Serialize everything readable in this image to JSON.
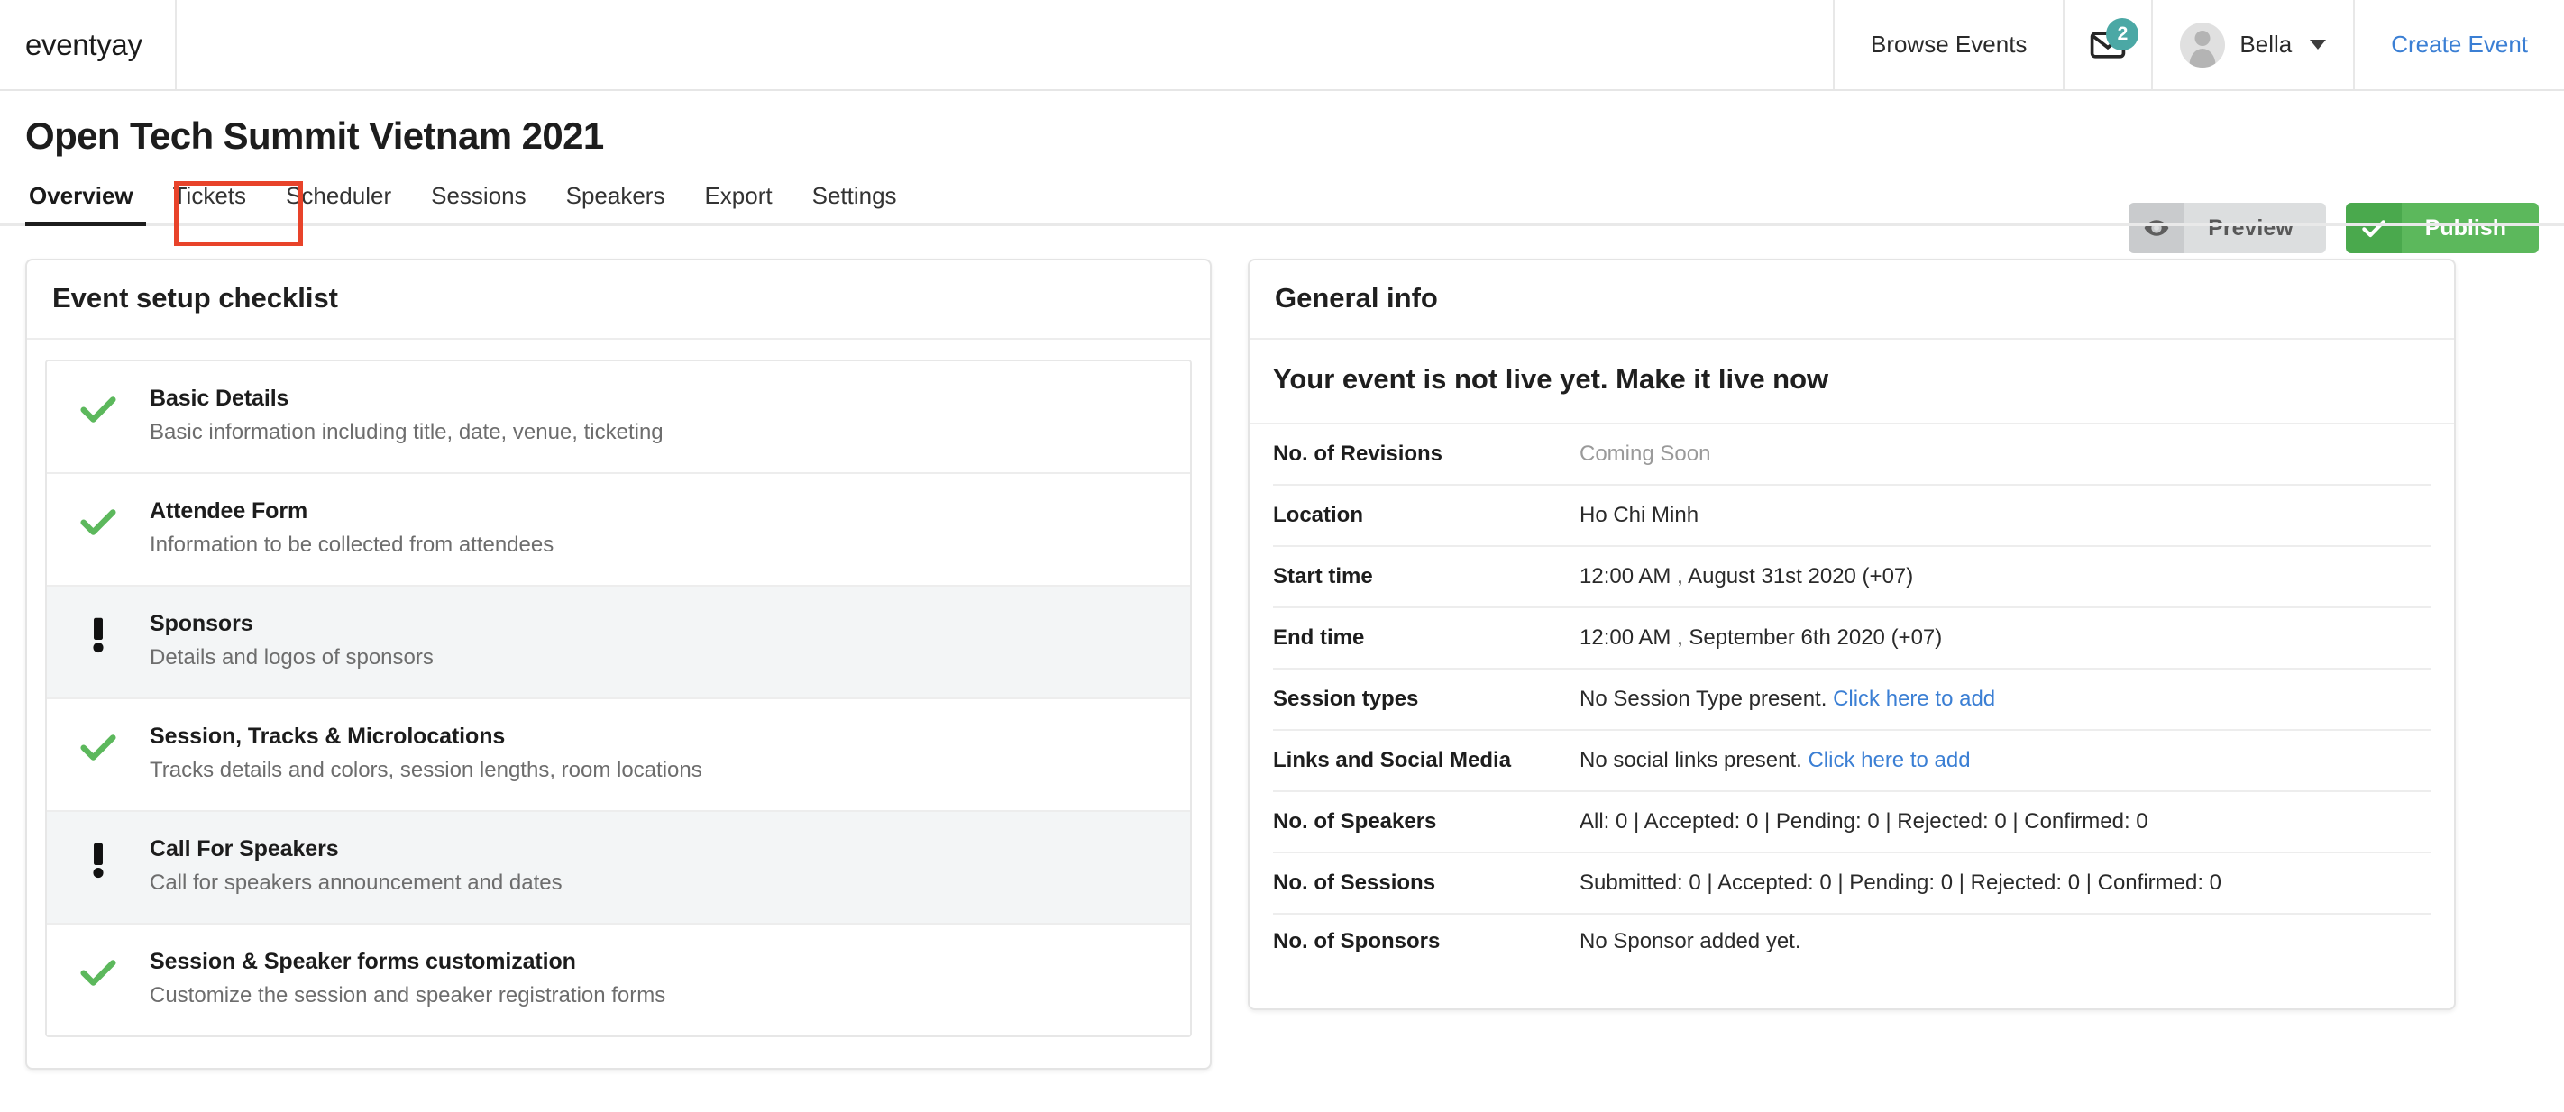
{
  "brand": {
    "name": "eventyay"
  },
  "navbar": {
    "browse_events": "Browse Events",
    "mail_icon": "mail-icon",
    "mail_badge_count": "2",
    "user_name": "Bella",
    "create_event": "Create Event",
    "badge_color": "#4ba8a5",
    "link_color": "#3b7fd4"
  },
  "header": {
    "title": "Open Tech Summit Vietnam 2021",
    "preview_label": "Preview",
    "preview_icon": "eye-icon",
    "publish_label": "Publish",
    "publish_icon": "check-icon",
    "publish_color": "#5cb85c"
  },
  "tabs": {
    "items": [
      {
        "label": "Overview",
        "active": true
      },
      {
        "label": "Tickets",
        "active": false,
        "highlighted": true
      },
      {
        "label": "Scheduler",
        "active": false
      },
      {
        "label": "Sessions",
        "active": false
      },
      {
        "label": "Speakers",
        "active": false
      },
      {
        "label": "Export",
        "active": false
      },
      {
        "label": "Settings",
        "active": false
      }
    ],
    "highlight_color": "#e8432a"
  },
  "checklist_panel": {
    "title": "Event setup checklist",
    "items": [
      {
        "name": "Basic Details",
        "desc": "Basic information including title, date, venue, ticketing",
        "status": "complete",
        "icon": "check-icon"
      },
      {
        "name": "Attendee Form",
        "desc": "Information to be collected from attendees",
        "status": "complete",
        "icon": "check-icon"
      },
      {
        "name": "Sponsors",
        "desc": "Details and logos of sponsors",
        "status": "incomplete",
        "icon": "exclamation-icon"
      },
      {
        "name": "Session, Tracks & Microlocations",
        "desc": "Tracks details and colors, session lengths, room locations",
        "status": "complete",
        "icon": "check-icon"
      },
      {
        "name": "Call For Speakers",
        "desc": "Call for speakers announcement and dates",
        "status": "incomplete",
        "icon": "exclamation-icon"
      },
      {
        "name": "Session & Speaker forms customization",
        "desc": "Customize the session and speaker registration forms",
        "status": "complete",
        "icon": "check-icon"
      }
    ],
    "complete_color": "#5cb85c"
  },
  "general_info": {
    "title": "General info",
    "live_notice": "Your event is not live yet. Make it live now",
    "rows": [
      {
        "label": "No. of Revisions",
        "value": "Coming Soon",
        "muted": true
      },
      {
        "label": "Location",
        "value": "Ho Chi Minh"
      },
      {
        "label": "Start time",
        "value": "12:00 AM , August 31st 2020 (+07)"
      },
      {
        "label": "End time",
        "value": "12:00 AM , September 6th 2020 (+07)"
      },
      {
        "label": "Session types",
        "value": "No Session Type present.",
        "link": "Click here to add"
      },
      {
        "label": "Links and Social Media",
        "value": "No social links present.",
        "link": "Click here to add"
      },
      {
        "label": "No. of Speakers",
        "value": "All: 0 | Accepted: 0 | Pending: 0 | Rejected: 0 | Confirmed: 0"
      },
      {
        "label": "No. of Sessions",
        "value": "Submitted: 0 | Accepted: 0 | Pending: 0 | Rejected: 0 | Confirmed: 0"
      },
      {
        "label": "No. of Sponsors",
        "value": "No Sponsor added yet."
      }
    ]
  }
}
